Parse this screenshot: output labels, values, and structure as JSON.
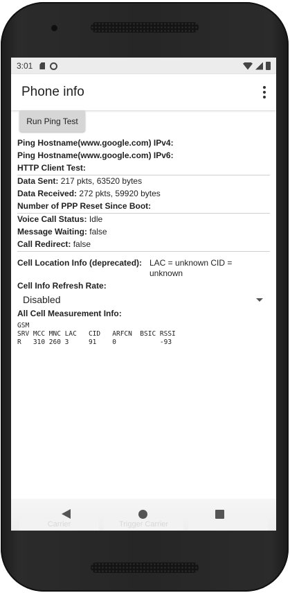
{
  "statusbar": {
    "time": "3:01"
  },
  "appbar": {
    "title": "Phone info"
  },
  "buttons": {
    "run_ping": "Run Ping Test"
  },
  "rows": {
    "ping_ipv4": {
      "label": "Ping Hostname(www.google.com) IPv4:",
      "value": ""
    },
    "ping_ipv6": {
      "label": "Ping Hostname(www.google.com) IPv6:",
      "value": ""
    },
    "http_client": {
      "label": "HTTP Client Test:",
      "value": ""
    },
    "data_sent": {
      "label": "Data Sent:",
      "value": "217 pkts, 63520 bytes"
    },
    "data_received": {
      "label": "Data Received:",
      "value": "272 pkts, 59920 bytes"
    },
    "ppp_reset": {
      "label": "Number of PPP Reset Since Boot:",
      "value": ""
    },
    "voice_call": {
      "label": "Voice Call Status:",
      "value": "Idle"
    },
    "message_waiting": {
      "label": "Message Waiting:",
      "value": "false"
    },
    "call_redirect": {
      "label": "Call Redirect:",
      "value": "false"
    },
    "cell_location": {
      "label": "Cell Location Info (deprecated):",
      "value": "LAC = unknown   CID = unknown"
    },
    "refresh_rate": {
      "label": "Cell Info Refresh Rate:"
    },
    "all_cell": {
      "label": "All Cell Measurement Info:"
    }
  },
  "refresh_dropdown": {
    "selected": "Disabled"
  },
  "cell_table": {
    "network": "GSM",
    "header": "SRV MCC MNC LAC   CID   ARFCN  BSIC RSSI",
    "row": "R   310 260 3     91    0           -93"
  },
  "navbar": {
    "ghost_left": "Carrier",
    "ghost_mid": "Trigger Carrier",
    "ghost_right": ""
  },
  "colors": {
    "frame": "#262626",
    "statusbar": "#ececec",
    "button": "#d6d6d6"
  }
}
